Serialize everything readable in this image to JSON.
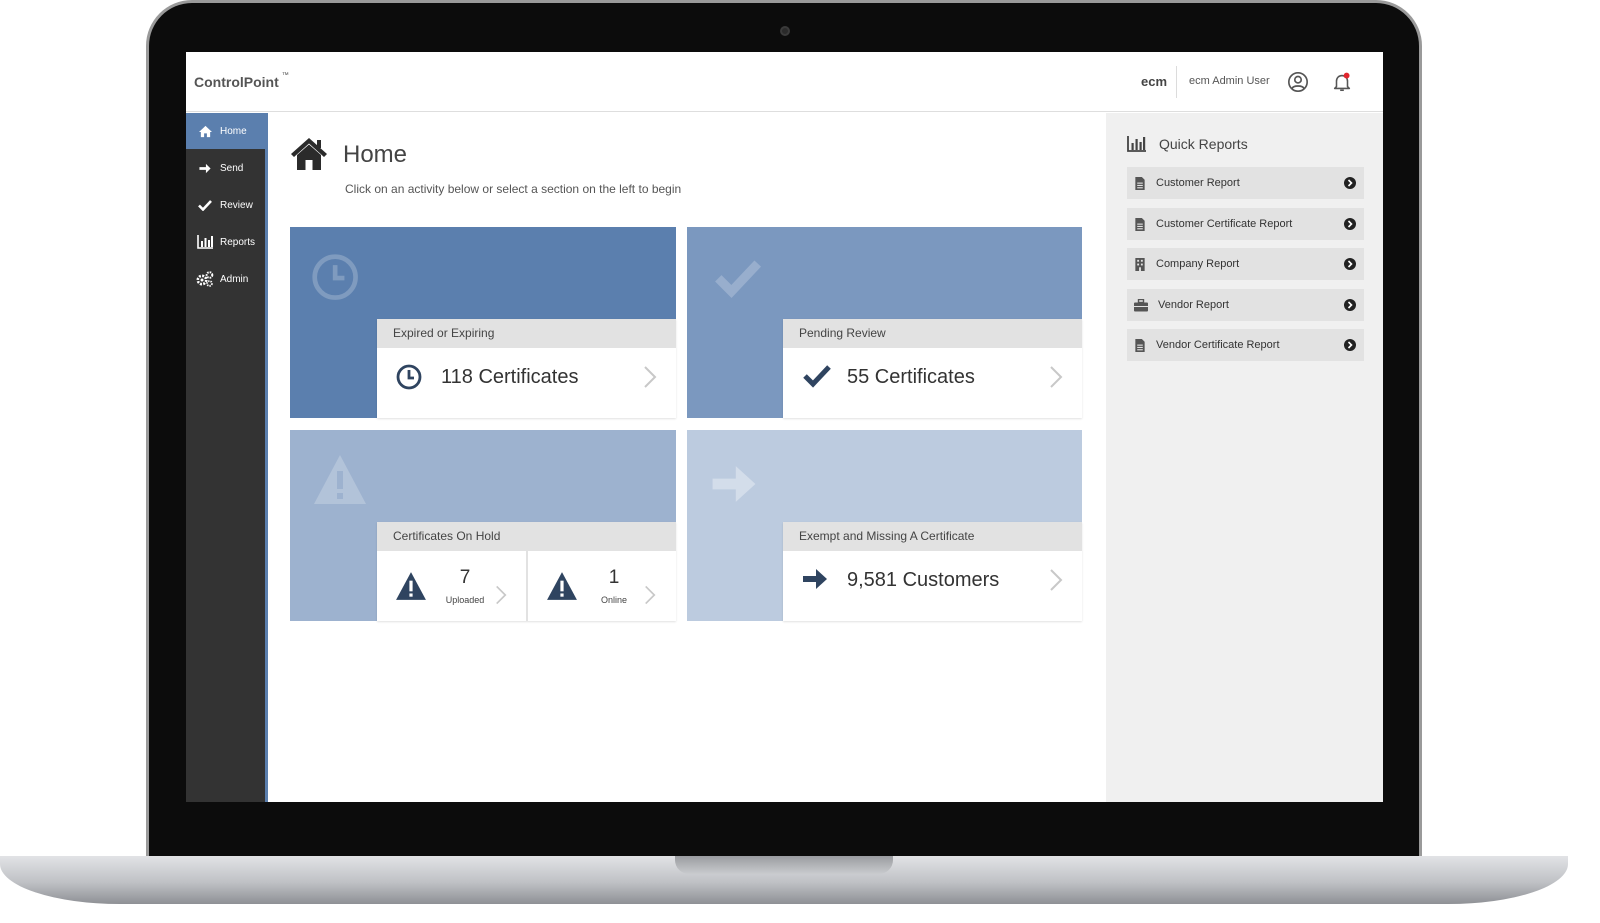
{
  "app": {
    "brand": "ControlPoint",
    "trademark": "™"
  },
  "header": {
    "company": "ecm",
    "user_name": "ecm Admin User"
  },
  "sidebar": {
    "items": [
      {
        "label": "Home",
        "icon": "home-icon",
        "active": true
      },
      {
        "label": "Send",
        "icon": "arrow-right-icon",
        "active": false
      },
      {
        "label": "Review",
        "icon": "check-icon",
        "active": false
      },
      {
        "label": "Reports",
        "icon": "bar-chart-icon",
        "active": false
      },
      {
        "label": "Admin",
        "icon": "gears-icon",
        "active": false
      }
    ]
  },
  "main": {
    "title": "Home",
    "subtitle": "Click on an activity below or select a section on the left to begin",
    "tiles": [
      {
        "heading": "Expired or Expiring",
        "metric": "118 Certificates",
        "icon": "clock-icon",
        "color": "#5b7fae"
      },
      {
        "heading": "Pending Review",
        "metric": "55 Certificates",
        "icon": "check-icon",
        "color": "#7b98bf"
      },
      {
        "heading": "Certificates On Hold",
        "icon": "warning-icon",
        "color": "#9db2cf",
        "split": [
          {
            "value": "7",
            "label": "Uploaded"
          },
          {
            "value": "1",
            "label": "Online"
          }
        ]
      },
      {
        "heading": "Exempt and Missing A Certificate",
        "metric": "9,581 Customers",
        "icon": "arrow-right-icon",
        "color": "#bccbdf"
      }
    ]
  },
  "quick_reports": {
    "title": "Quick Reports",
    "items": [
      {
        "label": "Customer Report",
        "icon": "document-icon"
      },
      {
        "label": "Customer Certificate Report",
        "icon": "document-icon"
      },
      {
        "label": "Company Report",
        "icon": "building-icon"
      },
      {
        "label": "Vendor Report",
        "icon": "briefcase-icon"
      },
      {
        "label": "Vendor Certificate Report",
        "icon": "document-icon"
      }
    ]
  },
  "colors": {
    "accent": "#5b7fae",
    "sidebar_bg": "#333333",
    "icon_dark": "#2f4460",
    "notification_dot": "#e0262d"
  }
}
